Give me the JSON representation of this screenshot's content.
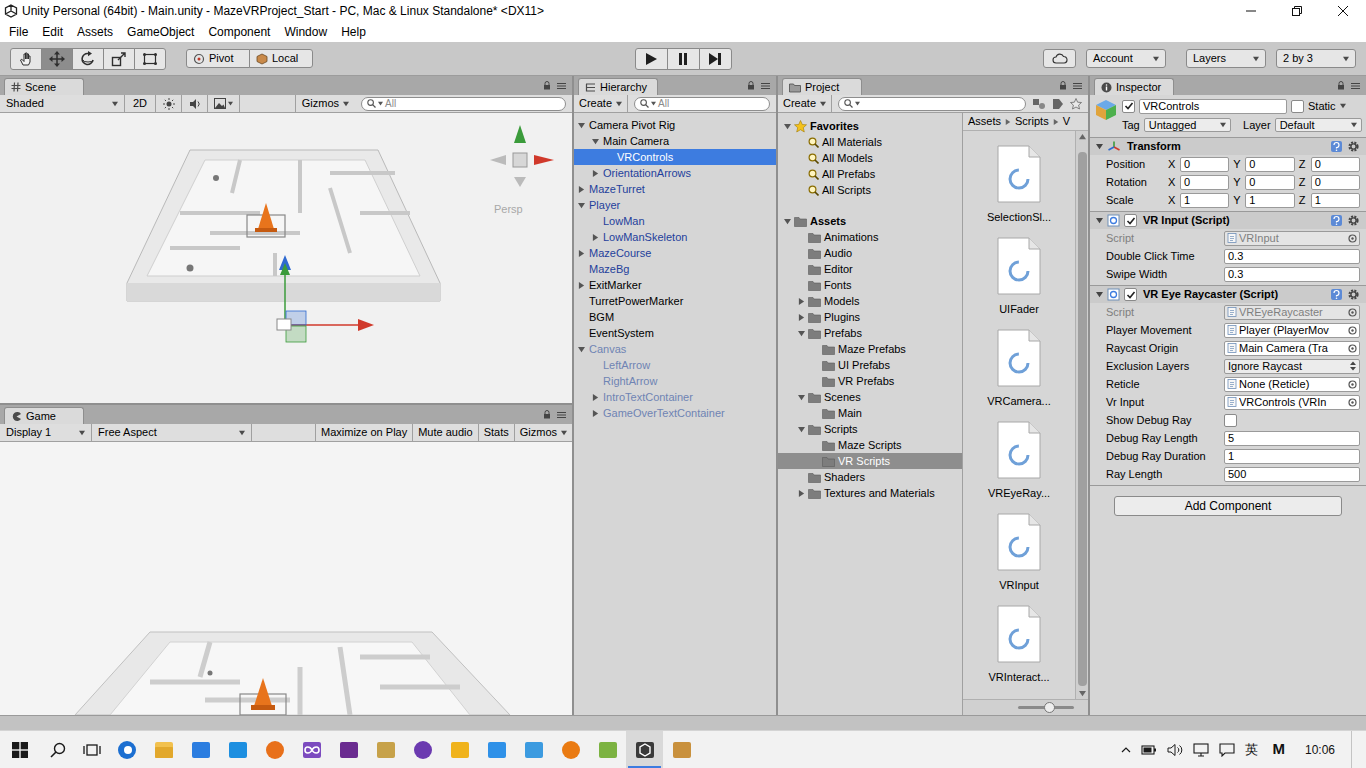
{
  "window": {
    "title": "Unity Personal (64bit) - Main.unity - MazeVRProject_Start - PC, Mac & Linux Standalone* <DX11>"
  },
  "menu": [
    "File",
    "Edit",
    "Assets",
    "GameObject",
    "Component",
    "Window",
    "Help"
  ],
  "toolbar": {
    "tools": [
      {
        "kind": "hand",
        "selected": false
      },
      {
        "kind": "move",
        "selected": true
      },
      {
        "kind": "rotate",
        "selected": false
      },
      {
        "kind": "scale",
        "selected": false
      },
      {
        "kind": "rect",
        "selected": false
      }
    ],
    "handles": [
      {
        "kind": "pivot",
        "label": "Pivot"
      },
      {
        "kind": "local",
        "label": "Local"
      }
    ],
    "playback": [
      {
        "kind": "play",
        "selected": false
      },
      {
        "kind": "pause",
        "selected": false
      },
      {
        "kind": "step",
        "selected": false
      }
    ],
    "account": "Account",
    "layers": "Layers",
    "layout": "2 by 3"
  },
  "scene": {
    "tab": "Scene",
    "shading": "Shaded",
    "mode": "2D",
    "gizmos": "Gizmos",
    "search": "All",
    "projection": "Persp"
  },
  "game": {
    "tab": "Game",
    "display": "Display 1",
    "aspect": "Free Aspect",
    "toggles": [
      {
        "label": "Maximize on Play",
        "on": false
      },
      {
        "label": "Mute audio",
        "on": false
      },
      {
        "label": "Stats",
        "on": false
      }
    ],
    "gizmos": "Gizmos"
  },
  "hierarchy": {
    "tab": "Hierarchy",
    "create": "Create",
    "search": "All",
    "items": [
      {
        "label": "Camera Pivot Rig",
        "prefab": false,
        "inactive": false,
        "selected": false,
        "expandable": true,
        "expanded": true,
        "children": [
          {
            "label": "Main Camera",
            "prefab": false,
            "inactive": false,
            "selected": false,
            "expandable": true,
            "expanded": true,
            "children": [
              {
                "label": "VRControls",
                "prefab": false,
                "inactive": false,
                "selected": true,
                "expandable": false,
                "expanded": false,
                "children": []
              }
            ]
          },
          {
            "label": "OrientationArrows",
            "prefab": true,
            "inactive": false,
            "selected": false,
            "expandable": true,
            "expanded": false,
            "children": []
          }
        ]
      },
      {
        "label": "MazeTurret",
        "prefab": true,
        "inactive": false,
        "selected": false,
        "expandable": true,
        "expanded": false,
        "children": []
      },
      {
        "label": "Player",
        "prefab": true,
        "inactive": false,
        "selected": false,
        "expandable": true,
        "expanded": true,
        "children": [
          {
            "label": "LowMan",
            "prefab": true,
            "inactive": false,
            "selected": false,
            "expandable": false,
            "expanded": false,
            "children": []
          },
          {
            "label": "LowManSkeleton",
            "prefab": true,
            "inactive": false,
            "selected": false,
            "expandable": true,
            "expanded": false,
            "children": []
          }
        ]
      },
      {
        "label": "MazeCourse",
        "prefab": true,
        "inactive": false,
        "selected": false,
        "expandable": true,
        "expanded": false,
        "children": []
      },
      {
        "label": "MazeBg",
        "prefab": true,
        "inactive": false,
        "selected": false,
        "expandable": false,
        "expanded": false,
        "children": []
      },
      {
        "label": "ExitMarker",
        "prefab": false,
        "inactive": false,
        "selected": false,
        "expandable": true,
        "expanded": false,
        "children": []
      },
      {
        "label": "TurretPowerMarker",
        "prefab": false,
        "inactive": false,
        "selected": false,
        "expandable": false,
        "expanded": false,
        "children": []
      },
      {
        "label": "BGM",
        "prefab": false,
        "inactive": false,
        "selected": false,
        "expandable": false,
        "expanded": false,
        "children": []
      },
      {
        "label": "EventSystem",
        "prefab": false,
        "inactive": false,
        "selected": false,
        "expandable": false,
        "expanded": false,
        "children": []
      },
      {
        "label": "Canvas",
        "prefab": true,
        "inactive": true,
        "selected": false,
        "expandable": true,
        "expanded": true,
        "children": [
          {
            "label": "LeftArrow",
            "prefab": true,
            "inactive": true,
            "selected": false,
            "expandable": false,
            "expanded": false,
            "children": []
          },
          {
            "label": "RightArrow",
            "prefab": true,
            "inactive": true,
            "selected": false,
            "expandable": false,
            "expanded": false,
            "children": []
          },
          {
            "label": "IntroTextContainer",
            "prefab": true,
            "inactive": true,
            "selected": false,
            "expandable": true,
            "expanded": false,
            "children": []
          },
          {
            "label": "GameOverTextContainer",
            "prefab": true,
            "inactive": true,
            "selected": false,
            "expandable": true,
            "expanded": false,
            "children": []
          }
        ]
      }
    ]
  },
  "project": {
    "tab": "Project",
    "create": "Create",
    "breadcrumb": [
      "Assets",
      "Scripts",
      "V"
    ],
    "tree": [
      {
        "label": "Favorites",
        "kind": "favorites",
        "bold": true,
        "selected": false,
        "expandable": true,
        "expanded": true,
        "children": [
          {
            "label": "All Materials",
            "kind": "search",
            "bold": false,
            "selected": false,
            "expandable": false,
            "expanded": false,
            "children": []
          },
          {
            "label": "All Models",
            "kind": "search",
            "bold": false,
            "selected": false,
            "expandable": false,
            "expanded": false,
            "children": []
          },
          {
            "label": "All Prefabs",
            "kind": "search",
            "bold": false,
            "selected": false,
            "expandable": false,
            "expanded": false,
            "children": []
          },
          {
            "label": "All Scripts",
            "kind": "search",
            "bold": false,
            "selected": false,
            "expandable": false,
            "expanded": false,
            "children": []
          }
        ]
      },
      {
        "label": "Assets",
        "kind": "folder",
        "bold": true,
        "selected": false,
        "expandable": true,
        "expanded": true,
        "children": [
          {
            "label": "Animations",
            "kind": "folder",
            "bold": false,
            "selected": false,
            "expandable": false,
            "expanded": false,
            "children": []
          },
          {
            "label": "Audio",
            "kind": "folder",
            "bold": false,
            "selected": false,
            "expandable": false,
            "expanded": false,
            "children": []
          },
          {
            "label": "Editor",
            "kind": "folder",
            "bold": false,
            "selected": false,
            "expandable": false,
            "expanded": false,
            "children": []
          },
          {
            "label": "Fonts",
            "kind": "folder",
            "bold": false,
            "selected": false,
            "expandable": false,
            "expanded": false,
            "children": []
          },
          {
            "label": "Models",
            "kind": "folder",
            "bold": false,
            "selected": false,
            "expandable": true,
            "expanded": false,
            "children": []
          },
          {
            "label": "Plugins",
            "kind": "folder",
            "bold": false,
            "selected": false,
            "expandable": true,
            "expanded": false,
            "children": []
          },
          {
            "label": "Prefabs",
            "kind": "folder",
            "bold": false,
            "selected": false,
            "expandable": true,
            "expanded": true,
            "children": [
              {
                "label": "Maze Prefabs",
                "kind": "folder",
                "bold": false,
                "selected": false,
                "expandable": false,
                "expanded": false,
                "children": []
              },
              {
                "label": "UI Prefabs",
                "kind": "folder",
                "bold": false,
                "selected": false,
                "expandable": false,
                "expanded": false,
                "children": []
              },
              {
                "label": "VR Prefabs",
                "kind": "folder",
                "bold": false,
                "selected": false,
                "expandable": false,
                "expanded": false,
                "children": []
              }
            ]
          },
          {
            "label": "Scenes",
            "kind": "folder",
            "bold": false,
            "selected": false,
            "expandable": true,
            "expanded": true,
            "children": [
              {
                "label": "Main",
                "kind": "folder",
                "bold": false,
                "selected": false,
                "expandable": false,
                "expanded": false,
                "children": []
              }
            ]
          },
          {
            "label": "Scripts",
            "kind": "folder",
            "bold": false,
            "selected": false,
            "expandable": true,
            "expanded": true,
            "children": [
              {
                "label": "Maze Scripts",
                "kind": "folder",
                "bold": false,
                "selected": false,
                "expandable": false,
                "expanded": false,
                "children": []
              },
              {
                "label": "VR Scripts",
                "kind": "folder",
                "bold": false,
                "selected": true,
                "expandable": false,
                "expanded": false,
                "children": []
              }
            ]
          },
          {
            "label": "Shaders",
            "kind": "folder",
            "bold": false,
            "selected": false,
            "expandable": false,
            "expanded": false,
            "children": []
          },
          {
            "label": "Textures and Materials",
            "kind": "folder",
            "bold": false,
            "selected": false,
            "expandable": true,
            "expanded": false,
            "children": []
          }
        ]
      }
    ],
    "files": [
      {
        "label": "SelectionSl..."
      },
      {
        "label": "UIFader"
      },
      {
        "label": "VRCamera..."
      },
      {
        "label": "VREyeRay..."
      },
      {
        "label": "VRInput"
      },
      {
        "label": "VRInteract..."
      }
    ]
  },
  "inspector": {
    "tab": "Inspector",
    "object": {
      "name": "VRControls",
      "active": true,
      "static_label": "Static",
      "static": false,
      "tag_label": "Tag",
      "tag": "Untagged",
      "layer_label": "Layer",
      "layer": "Default"
    },
    "components": [
      {
        "kind": "transform",
        "title": "Transform",
        "vectors": [
          {
            "label": "Position",
            "values": [
              {
                "axis": "X",
                "value": "0"
              },
              {
                "axis": "Y",
                "value": "0"
              },
              {
                "axis": "Z",
                "value": "0"
              }
            ]
          },
          {
            "label": "Rotation",
            "values": [
              {
                "axis": "X",
                "value": "0"
              },
              {
                "axis": "Y",
                "value": "0"
              },
              {
                "axis": "Z",
                "value": "0"
              }
            ]
          },
          {
            "label": "Scale",
            "values": [
              {
                "axis": "X",
                "value": "1"
              },
              {
                "axis": "Y",
                "value": "1"
              },
              {
                "axis": "Z",
                "value": "1"
              }
            ]
          }
        ]
      },
      {
        "kind": "script",
        "title": "VR Input (Script)",
        "enabled": true,
        "fields": [
          {
            "label": "Script",
            "kind": "object",
            "value": "VRInput",
            "disabled": true
          },
          {
            "label": "Double Click Time",
            "kind": "number",
            "value": "0.3",
            "disabled": false
          },
          {
            "label": "Swipe Width",
            "kind": "number",
            "value": "0.3",
            "disabled": false
          }
        ]
      },
      {
        "kind": "script",
        "title": "VR Eye Raycaster (Script)",
        "enabled": true,
        "fields": [
          {
            "label": "Script",
            "kind": "object",
            "value": "VREyeRaycaster",
            "disabled": true
          },
          {
            "label": "Player Movement",
            "kind": "object",
            "value": "Player (PlayerMov",
            "disabled": false
          },
          {
            "label": "Raycast Origin",
            "kind": "object",
            "value": "Main Camera (Tra",
            "disabled": false
          },
          {
            "label": "Exclusion Layers",
            "kind": "enum",
            "value": "Ignore Raycast",
            "disabled": false
          },
          {
            "label": "Reticle",
            "kind": "object",
            "value": "None (Reticle)",
            "disabled": false
          },
          {
            "label": "Vr Input",
            "kind": "object",
            "value": "VRControls (VRIn",
            "disabled": false
          },
          {
            "label": "Show Debug Ray",
            "kind": "checkbox",
            "checked": false,
            "disabled": false
          },
          {
            "label": "Debug Ray Length",
            "kind": "number",
            "value": "5",
            "disabled": false
          },
          {
            "label": "Debug Ray Duration",
            "kind": "number",
            "value": "1",
            "disabled": false
          },
          {
            "label": "Ray Length",
            "kind": "number",
            "value": "500",
            "disabled": false
          }
        ]
      }
    ],
    "add_component": "Add Component"
  },
  "taskbar": {
    "apps": [
      {
        "kind": "edge",
        "active": false
      },
      {
        "kind": "explorer",
        "active": false
      },
      {
        "kind": "store",
        "active": false
      },
      {
        "kind": "photos",
        "active": false
      },
      {
        "kind": "firefox",
        "active": false
      },
      {
        "kind": "infinity",
        "active": false
      },
      {
        "kind": "visual-studio",
        "active": false
      },
      {
        "kind": "lol",
        "active": false
      },
      {
        "kind": "orb",
        "active": false
      },
      {
        "kind": "yellow",
        "active": false
      },
      {
        "kind": "blue",
        "active": false
      },
      {
        "kind": "bird",
        "active": false
      },
      {
        "kind": "blender",
        "active": false
      },
      {
        "kind": "android",
        "active": false
      },
      {
        "kind": "unity",
        "active": true
      },
      {
        "kind": "notebook",
        "active": false
      }
    ],
    "tray": {
      "input_method": "英",
      "ime_mode": "M",
      "time": "10:06"
    }
  }
}
